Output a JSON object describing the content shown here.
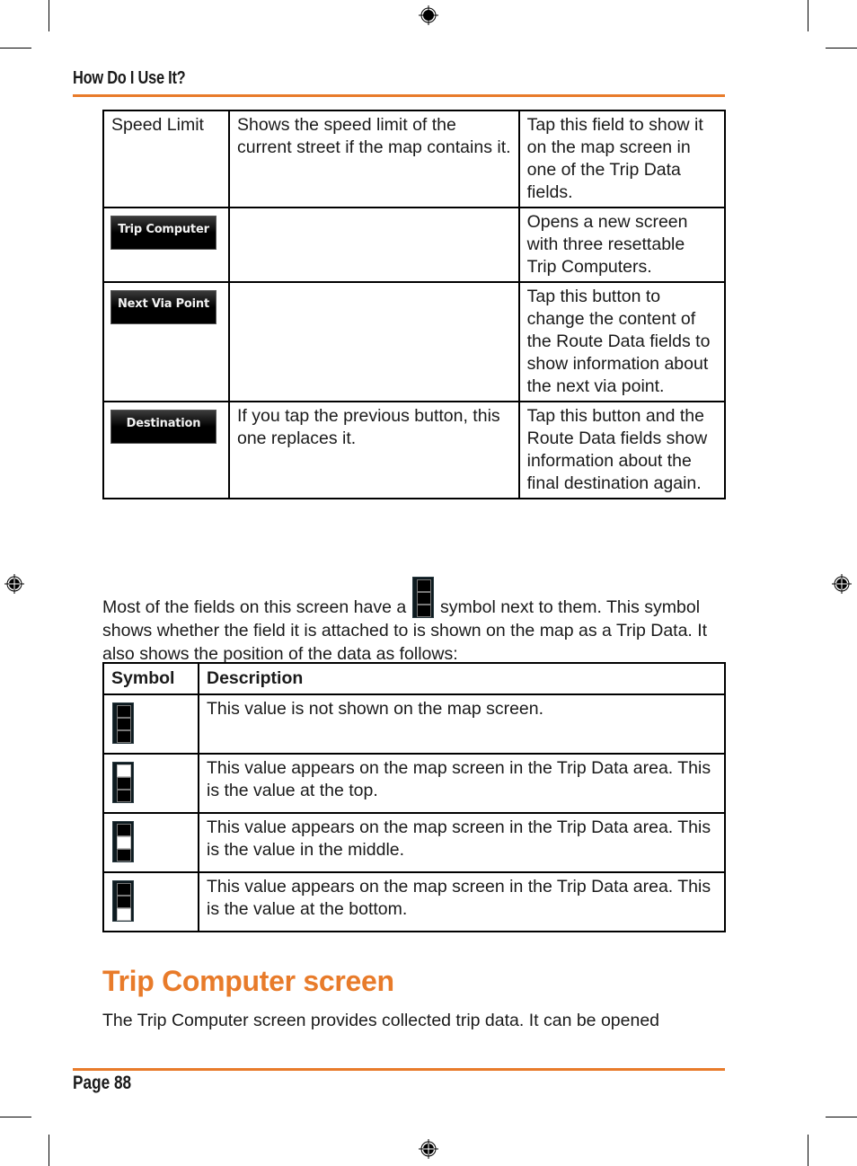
{
  "header": {
    "title": "How Do I Use It?"
  },
  "accent_color": "#e87b2a",
  "feature_table": {
    "rows": [
      {
        "col1_text": "Speed Limit",
        "col1_button": null,
        "col2": "Shows the speed limit of the current street if the map contains it.",
        "col3": "Tap this field to show it on the map screen in one of the Trip Data fields."
      },
      {
        "col1_text": null,
        "col1_button": "Trip Computer",
        "col2": "",
        "col3": "Opens a new screen with three resettable Trip Computers."
      },
      {
        "col1_text": null,
        "col1_button": "Next Via Point",
        "col2": "",
        "col3": "Tap this button to change the content of the Route Data fields to show information about the next via point."
      },
      {
        "col1_text": null,
        "col1_button": "Destination",
        "col2": "If you tap the previous button, this one replaces it.",
        "col3": "Tap this button and the Route Data fields show information about the final destination again."
      }
    ]
  },
  "intro_paragraph": {
    "before_symbol": "Most of the fields on this screen have a",
    "symbol_icon": "trip-data-position-icon-none",
    "after_symbol": "symbol next to them. This symbol shows whether the field it is attached to is shown on the map as a Trip Data. It also shows the position of the data as follows:"
  },
  "symbol_table": {
    "headers": [
      "Symbol",
      "Description"
    ],
    "rows": [
      {
        "icon": "trip-data-none-icon",
        "lit": "none",
        "description": "This value is not shown on the map screen."
      },
      {
        "icon": "trip-data-top-icon",
        "lit": "top",
        "description": "This value appears on the map screen in the Trip Data area. This is the value at the top."
      },
      {
        "icon": "trip-data-middle-icon",
        "lit": "middle",
        "description": "This value appears on the map screen in the Trip Data area. This is the value in the middle."
      },
      {
        "icon": "trip-data-bottom-icon",
        "lit": "bottom",
        "description": "This value appears on the map screen in the Trip Data area. This is the value at the bottom."
      }
    ]
  },
  "section": {
    "title": "Trip Computer screen",
    "body": "The Trip Computer screen provides collected trip data. It can be opened"
  },
  "footer": {
    "page_label": "Page 88"
  }
}
